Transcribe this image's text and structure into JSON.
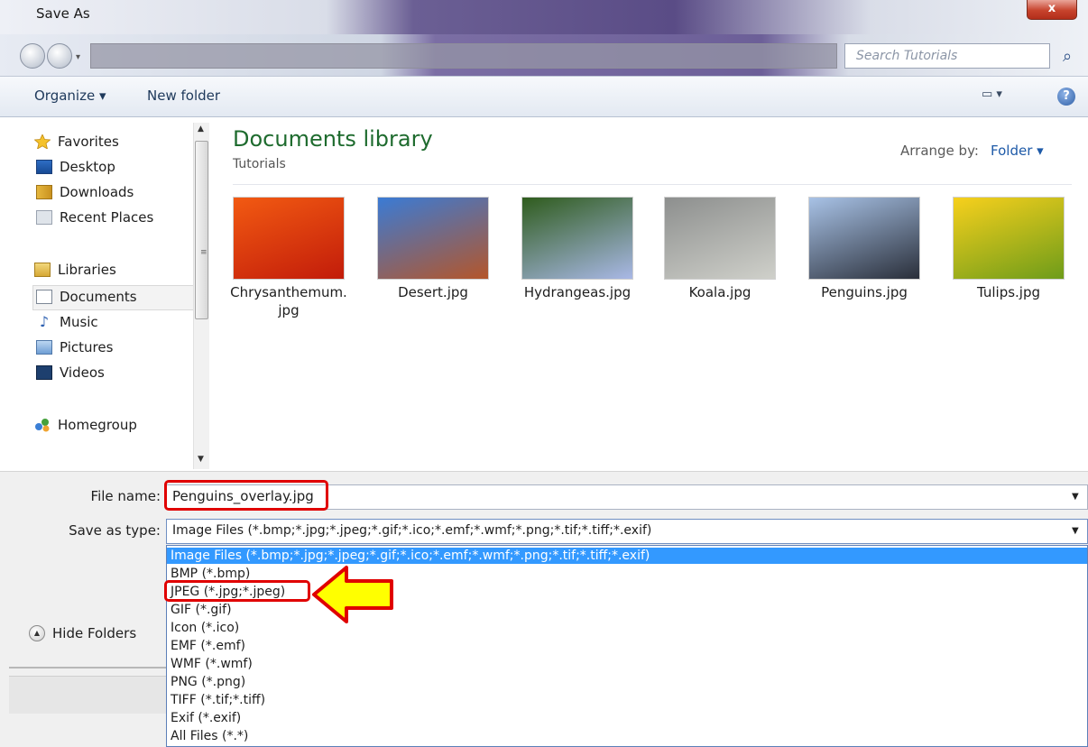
{
  "window": {
    "title": "Save As",
    "close_label": "x"
  },
  "nav": {
    "search_placeholder": "Search Tutorials"
  },
  "toolbar": {
    "organize_label": "Organize ▾",
    "new_folder_label": "New folder",
    "view_label": "▭ ▾",
    "help_label": "?"
  },
  "sidebar": {
    "favorites": {
      "label": "Favorites",
      "items": [
        "Desktop",
        "Downloads",
        "Recent Places"
      ]
    },
    "libraries": {
      "label": "Libraries",
      "items": [
        "Documents",
        "Music",
        "Pictures",
        "Videos"
      ]
    },
    "homegroup": "Homegroup",
    "selected": "Documents"
  },
  "content": {
    "title": "Documents library",
    "subtitle": "Tutorials",
    "arrange_label": "Arrange by:",
    "arrange_value": "Folder ▾",
    "files": [
      {
        "name_line1": "Chrysanthemum.",
        "name_line2": "jpg",
        "colors": [
          "#f25a12",
          "#c21c0a"
        ]
      },
      {
        "name_line1": "Desert.jpg",
        "name_line2": "",
        "colors": [
          "#3a7bd5",
          "#b4562a"
        ]
      },
      {
        "name_line1": "Hydrangeas.jpg",
        "name_line2": "",
        "colors": [
          "#2f5c1d",
          "#a9b8e6"
        ]
      },
      {
        "name_line1": "Koala.jpg",
        "name_line2": "",
        "colors": [
          "#8d8f8e",
          "#cfd0ca"
        ]
      },
      {
        "name_line1": "Penguins.jpg",
        "name_line2": "",
        "colors": [
          "#a8c2e6",
          "#2a2f3a"
        ]
      },
      {
        "name_line1": "Tulips.jpg",
        "name_line2": "",
        "colors": [
          "#f7d01c",
          "#6e9c1a"
        ]
      }
    ]
  },
  "form": {
    "file_name_label": "File name:",
    "file_name_value": "Penguins_overlay.jpg",
    "save_type_label": "Save as type:",
    "save_type_value": "Image Files (*.bmp;*.jpg;*.jpeg;*.gif;*.ico;*.emf;*.wmf;*.png;*.tif;*.tiff;*.exif)",
    "hide_folders_label": "Hide Folders"
  },
  "dropdown_options": [
    "Image Files (*.bmp;*.jpg;*.jpeg;*.gif;*.ico;*.emf;*.wmf;*.png;*.tif;*.tiff;*.exif)",
    "BMP (*.bmp)",
    "JPEG (*.jpg;*.jpeg)",
    "GIF (*.gif)",
    "Icon (*.ico)",
    "EMF (*.emf)",
    "WMF (*.wmf)",
    "PNG (*.png)",
    "TIFF (*.tif;*.tiff)",
    "Exif (*.exif)",
    "All Files (*.*)"
  ],
  "colors": {
    "highlight": "#e00000",
    "arrow_fill": "#ffff00",
    "selection": "#3399ff",
    "library_title": "#1e6b2e"
  }
}
